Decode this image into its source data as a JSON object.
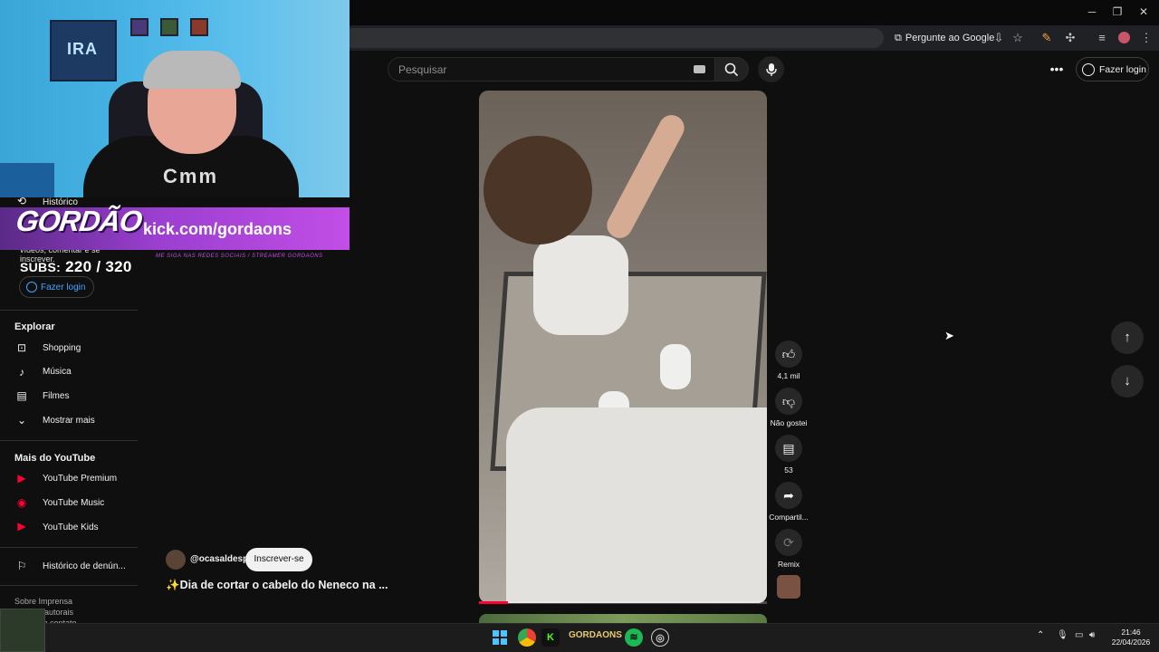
{
  "browser": {
    "ask_google": "Pergunte ao Google",
    "window_controls": {
      "minimize": "─",
      "restore": "❐",
      "close": "✕"
    }
  },
  "header": {
    "search_placeholder": "Pesquisar",
    "login_label": "Fazer login"
  },
  "overlay": {
    "poster_text": "IRA",
    "shirt_print": "Cmm",
    "banner_logo": "GORDÃO",
    "banner_url": "kick.com/gordaons",
    "banner_tag": "ME SIGA NAS REDES SOCIAIS / STREAMER GORDAONS",
    "subs_label": "SUBS:",
    "subs_value": "220 / 320"
  },
  "sidebar": {
    "historico": "Histórico",
    "partial_text": "vídeos, comentar e se inscrever.",
    "login_label": "Fazer login",
    "explore_heading": "Explorar",
    "explore_items": [
      {
        "label": "Shopping",
        "icon": "shopping-bag-icon"
      },
      {
        "label": "Música",
        "icon": "music-note-icon"
      },
      {
        "label": "Filmes",
        "icon": "film-icon"
      },
      {
        "label": "Mostrar mais",
        "icon": "chevron-down-icon"
      }
    ],
    "more_heading": "Mais do YouTube",
    "more_items": [
      {
        "label": "YouTube Premium"
      },
      {
        "label": "YouTube Music"
      },
      {
        "label": "YouTube Kids"
      }
    ],
    "report_history": "Histórico de denún...",
    "footer_line1": "Sobre   Imprensa",
    "footer_line2": "Direitos autorais",
    "footer_line3": "Entre em contato"
  },
  "short": {
    "channel": "@ocasaldesp",
    "subscribe_label": "Inscrever-se",
    "title": "✨Dia de cortar o cabelo do Neneco na ...",
    "progress": 0.1
  },
  "actions": {
    "likes": "4,1 mil",
    "dislike_label": "Não gostei",
    "comments": "53",
    "share_label": "Compartil...",
    "remix_label": "Remix"
  },
  "taskbar": {
    "app_label": "GORDAONS",
    "time": "21:46",
    "date": "22/04/2026"
  },
  "colors": {
    "youtube_red": "#ff0033",
    "link_blue": "#3ea6ff",
    "kick_green": "#53fc18",
    "spotify_green": "#1db954"
  }
}
